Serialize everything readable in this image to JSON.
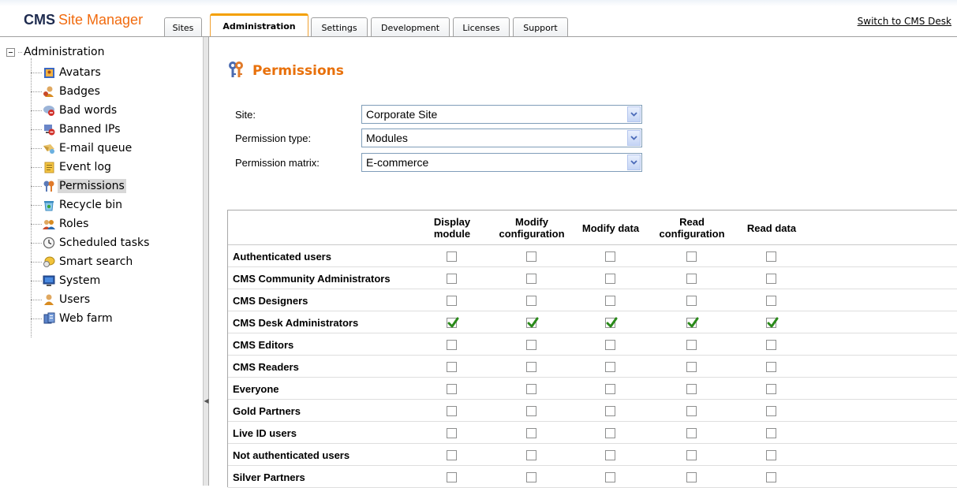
{
  "header": {
    "logo_strong": "CMS",
    "logo_rest": "Site Manager",
    "tabs": [
      {
        "label": "Sites"
      },
      {
        "label": "Administration"
      },
      {
        "label": "Settings"
      },
      {
        "label": "Development"
      },
      {
        "label": "Licenses"
      },
      {
        "label": "Support"
      }
    ],
    "active_tab": "Administration",
    "switch_link": "Switch to CMS Desk"
  },
  "sidebar": {
    "root": "Administration",
    "items": [
      {
        "label": "Avatars",
        "icon": "avatars-icon"
      },
      {
        "label": "Badges",
        "icon": "badges-icon"
      },
      {
        "label": "Bad words",
        "icon": "bad-words-icon"
      },
      {
        "label": "Banned IPs",
        "icon": "banned-ips-icon"
      },
      {
        "label": "E-mail queue",
        "icon": "email-queue-icon"
      },
      {
        "label": "Event log",
        "icon": "event-log-icon"
      },
      {
        "label": "Permissions",
        "icon": "permissions-icon"
      },
      {
        "label": "Recycle bin",
        "icon": "recycle-bin-icon"
      },
      {
        "label": "Roles",
        "icon": "roles-icon"
      },
      {
        "label": "Scheduled tasks",
        "icon": "scheduled-tasks-icon"
      },
      {
        "label": "Smart search",
        "icon": "smart-search-icon"
      },
      {
        "label": "System",
        "icon": "system-icon"
      },
      {
        "label": "Users",
        "icon": "users-icon"
      },
      {
        "label": "Web farm",
        "icon": "web-farm-icon"
      }
    ],
    "selected": "Permissions"
  },
  "main": {
    "title": "Permissions",
    "form": {
      "site_label": "Site:",
      "site_value": "Corporate Site",
      "type_label": "Permission type:",
      "type_value": "Modules",
      "matrix_label": "Permission matrix:",
      "matrix_value": "E-commerce"
    },
    "matrix": {
      "columns": [
        "Display\nmodule",
        "Modify\nconfiguration",
        "Modify data",
        "Read\nconfiguration",
        "Read data"
      ],
      "rows": [
        {
          "role": "Authenticated users",
          "checks": [
            false,
            false,
            false,
            false,
            false
          ]
        },
        {
          "role": "CMS Community Administrators",
          "checks": [
            false,
            false,
            false,
            false,
            false
          ]
        },
        {
          "role": "CMS Designers",
          "checks": [
            false,
            false,
            false,
            false,
            false
          ]
        },
        {
          "role": "CMS Desk Administrators",
          "checks": [
            true,
            true,
            true,
            true,
            true
          ]
        },
        {
          "role": "CMS Editors",
          "checks": [
            false,
            false,
            false,
            false,
            false
          ]
        },
        {
          "role": "CMS Readers",
          "checks": [
            false,
            false,
            false,
            false,
            false
          ]
        },
        {
          "role": "Everyone",
          "checks": [
            false,
            false,
            false,
            false,
            false
          ]
        },
        {
          "role": "Gold Partners",
          "checks": [
            false,
            false,
            false,
            false,
            false
          ]
        },
        {
          "role": "Live ID users",
          "checks": [
            false,
            false,
            false,
            false,
            false
          ]
        },
        {
          "role": "Not authenticated users",
          "checks": [
            false,
            false,
            false,
            false,
            false
          ]
        },
        {
          "role": "Silver Partners",
          "checks": [
            false,
            false,
            false,
            false,
            false
          ]
        }
      ]
    }
  },
  "colors": {
    "brand_dark": "#1e2b4f",
    "brand_orange": "#f16b0f",
    "title_orange": "#e8700a",
    "check_green": "#2a8a1a"
  }
}
